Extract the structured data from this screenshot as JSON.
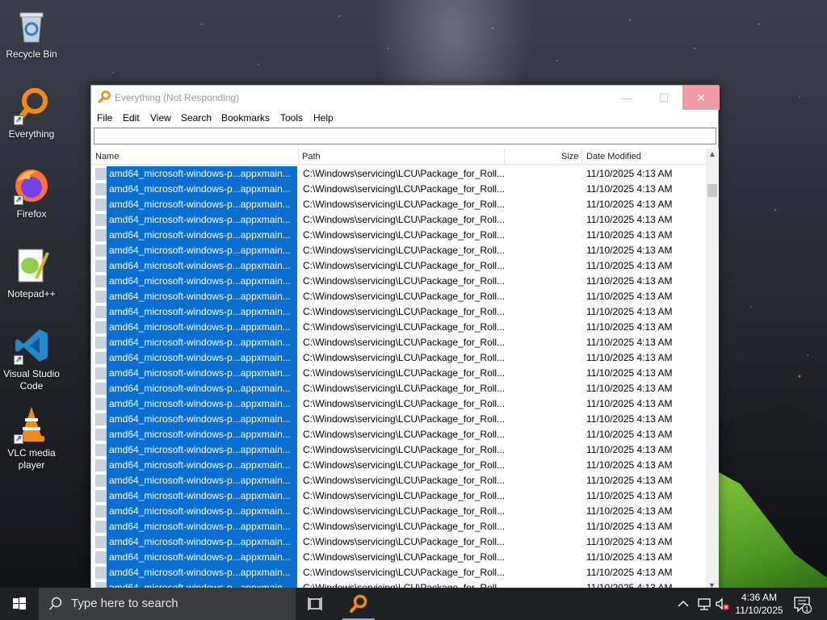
{
  "desktop": {
    "icons": [
      {
        "label": "Recycle Bin",
        "icon": "recycle-bin-icon"
      },
      {
        "label": "Everything",
        "icon": "everything-icon"
      },
      {
        "label": "Firefox",
        "icon": "firefox-icon"
      },
      {
        "label": "Notepad++",
        "icon": "notepadpp-icon"
      },
      {
        "label": "Visual Studio Code",
        "icon": "vscode-icon"
      },
      {
        "label": "VLC media player",
        "icon": "vlc-icon"
      }
    ]
  },
  "window": {
    "title": "Everything (Not Responding)",
    "search_value": "",
    "menu": [
      "File",
      "Edit",
      "View",
      "Search",
      "Bookmarks",
      "Tools",
      "Help"
    ],
    "columns": [
      "Name",
      "Path",
      "Size",
      "Date Modified"
    ],
    "rows": [
      {
        "name": "amd64_microsoft-windows-p...appxmain...",
        "path": "C:\\Windows\\servicing\\LCU\\Package_for_Roll...",
        "size": "",
        "date": "11/10/2025 4:13 AM"
      },
      {
        "name": "amd64_microsoft-windows-p...appxmain...",
        "path": "C:\\Windows\\servicing\\LCU\\Package_for_Roll...",
        "size": "",
        "date": "11/10/2025 4:13 AM"
      },
      {
        "name": "amd64_microsoft-windows-p...appxmain...",
        "path": "C:\\Windows\\servicing\\LCU\\Package_for_Roll...",
        "size": "",
        "date": "11/10/2025 4:13 AM"
      },
      {
        "name": "amd64_microsoft-windows-p...appxmain...",
        "path": "C:\\Windows\\servicing\\LCU\\Package_for_Roll...",
        "size": "",
        "date": "11/10/2025 4:13 AM"
      },
      {
        "name": "amd64_microsoft-windows-p...appxmain...",
        "path": "C:\\Windows\\servicing\\LCU\\Package_for_Roll...",
        "size": "",
        "date": "11/10/2025 4:13 AM"
      },
      {
        "name": "amd64_microsoft-windows-p...appxmain...",
        "path": "C:\\Windows\\servicing\\LCU\\Package_for_Roll...",
        "size": "",
        "date": "11/10/2025 4:13 AM"
      },
      {
        "name": "amd64_microsoft-windows-p...appxmain...",
        "path": "C:\\Windows\\servicing\\LCU\\Package_for_Roll...",
        "size": "",
        "date": "11/10/2025 4:13 AM"
      },
      {
        "name": "amd64_microsoft-windows-p...appxmain...",
        "path": "C:\\Windows\\servicing\\LCU\\Package_for_Roll...",
        "size": "",
        "date": "11/10/2025 4:13 AM"
      },
      {
        "name": "amd64_microsoft-windows-p...appxmain...",
        "path": "C:\\Windows\\servicing\\LCU\\Package_for_Roll...",
        "size": "",
        "date": "11/10/2025 4:13 AM"
      },
      {
        "name": "amd64_microsoft-windows-p...appxmain...",
        "path": "C:\\Windows\\servicing\\LCU\\Package_for_Roll...",
        "size": "",
        "date": "11/10/2025 4:13 AM"
      },
      {
        "name": "amd64_microsoft-windows-p...appxmain...",
        "path": "C:\\Windows\\servicing\\LCU\\Package_for_Roll...",
        "size": "",
        "date": "11/10/2025 4:13 AM"
      },
      {
        "name": "amd64_microsoft-windows-p...appxmain...",
        "path": "C:\\Windows\\servicing\\LCU\\Package_for_Roll...",
        "size": "",
        "date": "11/10/2025 4:13 AM"
      },
      {
        "name": "amd64_microsoft-windows-p...appxmain...",
        "path": "C:\\Windows\\servicing\\LCU\\Package_for_Roll...",
        "size": "",
        "date": "11/10/2025 4:13 AM"
      },
      {
        "name": "amd64_microsoft-windows-p...appxmain...",
        "path": "C:\\Windows\\servicing\\LCU\\Package_for_Roll...",
        "size": "",
        "date": "11/10/2025 4:13 AM"
      },
      {
        "name": "amd64_microsoft-windows-p...appxmain...",
        "path": "C:\\Windows\\servicing\\LCU\\Package_for_Roll...",
        "size": "",
        "date": "11/10/2025 4:13 AM"
      },
      {
        "name": "amd64_microsoft-windows-p...appxmain...",
        "path": "C:\\Windows\\servicing\\LCU\\Package_for_Roll...",
        "size": "",
        "date": "11/10/2025 4:13 AM"
      },
      {
        "name": "amd64_microsoft-windows-p...appxmain...",
        "path": "C:\\Windows\\servicing\\LCU\\Package_for_Roll...",
        "size": "",
        "date": "11/10/2025 4:13 AM"
      },
      {
        "name": "amd64_microsoft-windows-p...appxmain...",
        "path": "C:\\Windows\\servicing\\LCU\\Package_for_Roll...",
        "size": "",
        "date": "11/10/2025 4:13 AM"
      },
      {
        "name": "amd64_microsoft-windows-p...appxmain...",
        "path": "C:\\Windows\\servicing\\LCU\\Package_for_Roll...",
        "size": "",
        "date": "11/10/2025 4:13 AM"
      },
      {
        "name": "amd64_microsoft-windows-p...appxmain...",
        "path": "C:\\Windows\\servicing\\LCU\\Package_for_Roll...",
        "size": "",
        "date": "11/10/2025 4:13 AM"
      },
      {
        "name": "amd64_microsoft-windows-p...appxmain...",
        "path": "C:\\Windows\\servicing\\LCU\\Package_for_Roll...",
        "size": "",
        "date": "11/10/2025 4:13 AM"
      },
      {
        "name": "amd64_microsoft-windows-p...appxmain...",
        "path": "C:\\Windows\\servicing\\LCU\\Package_for_Roll...",
        "size": "",
        "date": "11/10/2025 4:13 AM"
      },
      {
        "name": "amd64_microsoft-windows-p...appxmain...",
        "path": "C:\\Windows\\servicing\\LCU\\Package_for_Roll...",
        "size": "",
        "date": "11/10/2025 4:13 AM"
      },
      {
        "name": "amd64_microsoft-windows-p...appxmain...",
        "path": "C:\\Windows\\servicing\\LCU\\Package_for_Roll...",
        "size": "",
        "date": "11/10/2025 4:13 AM"
      },
      {
        "name": "amd64_microsoft-windows-p...appxmain...",
        "path": "C:\\Windows\\servicing\\LCU\\Package_for_Roll...",
        "size": "",
        "date": "11/10/2025 4:13 AM"
      },
      {
        "name": "amd64_microsoft-windows-p...appxmain...",
        "path": "C:\\Windows\\servicing\\LCU\\Package_for_Roll...",
        "size": "",
        "date": "11/10/2025 4:13 AM"
      },
      {
        "name": "amd64_microsoft-windows-p...appxmain...",
        "path": "C:\\Windows\\servicing\\LCU\\Package_for_Roll...",
        "size": "",
        "date": "11/10/2025 4:13 AM"
      },
      {
        "name": "amd64_microsoft-windows-p...appxmain...",
        "path": "C:\\Windows\\servicing\\LCU\\Package_for_Roll...",
        "size": "",
        "date": "11/10/2025 4:13 AM"
      }
    ]
  },
  "taskbar": {
    "search_placeholder": "Type here to search",
    "time": "4:36 AM",
    "date": "11/10/2025",
    "notification_count": "1"
  },
  "colors": {
    "selection": "#0a6fd0",
    "taskbar": "#1f2023",
    "search_box": "#3a3b3e"
  }
}
